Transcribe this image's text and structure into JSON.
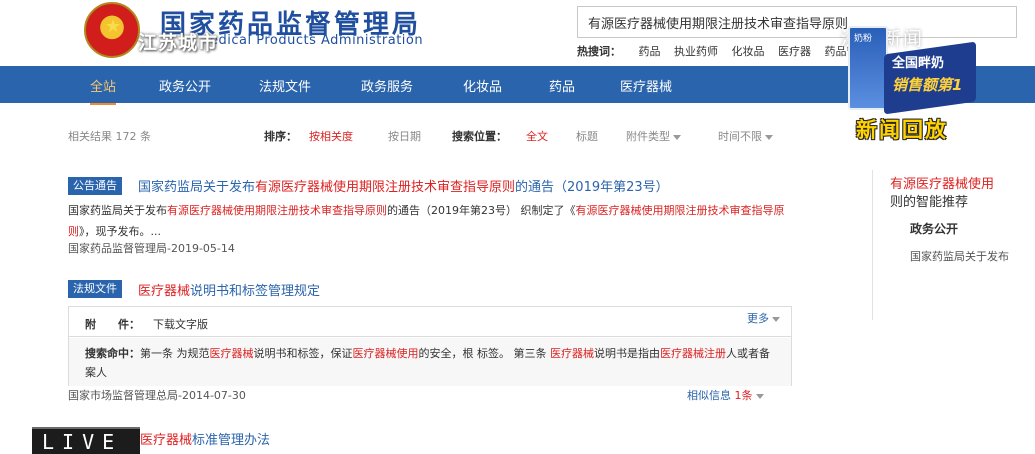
{
  "header": {
    "title": "国家药品监督管理局",
    "subtitle_visible": "edical Products Administration",
    "watermark_city": "江苏城市",
    "search_value": "有源医疗器械使用期限注册技术审查指导原则",
    "hot_label": "热搜词：",
    "hot_terms": [
      "药品",
      "执业药师",
      "化妆品",
      "医疗器",
      "药品管理法"
    ],
    "watermark_right": "法规新闻"
  },
  "nav": {
    "items": [
      "全站",
      "政务公开",
      "法规文件",
      "政务服务",
      "化妆品",
      "药品",
      "医疗器械"
    ]
  },
  "ad": {
    "box_label": "奶粉",
    "line1": "全国畔奶",
    "line2": "销售额第1",
    "replay": "新闻回放"
  },
  "filters": {
    "results_count": "相关结果 172 条",
    "sort_label": "排序：",
    "sort_relevance": "按相关度",
    "sort_date": "按日期",
    "position_label": "搜索位置：",
    "pos_all": "全文",
    "pos_title": "标题",
    "attach_type": "附件类型",
    "time_range": "时间不限"
  },
  "results": [
    {
      "tag": "公告通告",
      "title_pre": "国家药监局关于发布",
      "title_hl": "有源医疗器械使用期限注册技术审查指导原则",
      "title_post": "的通告（2019年第23号）",
      "snippet_1": "国家药监局关于发布",
      "snippet_hl1": "有源医疗器械使用期限注册技术审查指导原则",
      "snippet_2": "的通告（2019年第23号） 织制定了《",
      "snippet_hl2": "有源医疗器械使用期限注册技术审查指导原则",
      "snippet_3": "》，现予发布。...",
      "meta": "国家药品监督管理局-2019-05-14"
    },
    {
      "tag": "法规文件",
      "title_hl": "医疗器械",
      "title_post": "说明书和标签管理规定",
      "attach_label": "附　　件：",
      "attach_value": "下载文字版",
      "more": "更多",
      "hit_label": "搜索命中：",
      "hit_1": "第一条 为规范",
      "hit_hl1": "医疗器械",
      "hit_2": "说明书和标签，保证",
      "hit_hl2": "医疗器械使用",
      "hit_3": "的安全，根 标签。 第三条 ",
      "hit_hl3": "医疗器械",
      "hit_4": "说明书是指由",
      "hit_hl4": "医疗器械注册",
      "hit_5": "人或者备案人",
      "meta": "国家市场监督管理总局-2014-07-30",
      "similar_label": "相似信息",
      "similar_count": "1条"
    },
    {
      "title_hl": "医疗器械",
      "title_post": "标准管理办法"
    }
  ],
  "sidebar": {
    "title_hl": "有源医疗器械使用",
    "title_post": "则的智能推荐",
    "sub": "政务公开",
    "item": "国家药监局关于发布"
  },
  "live": "LIVE"
}
